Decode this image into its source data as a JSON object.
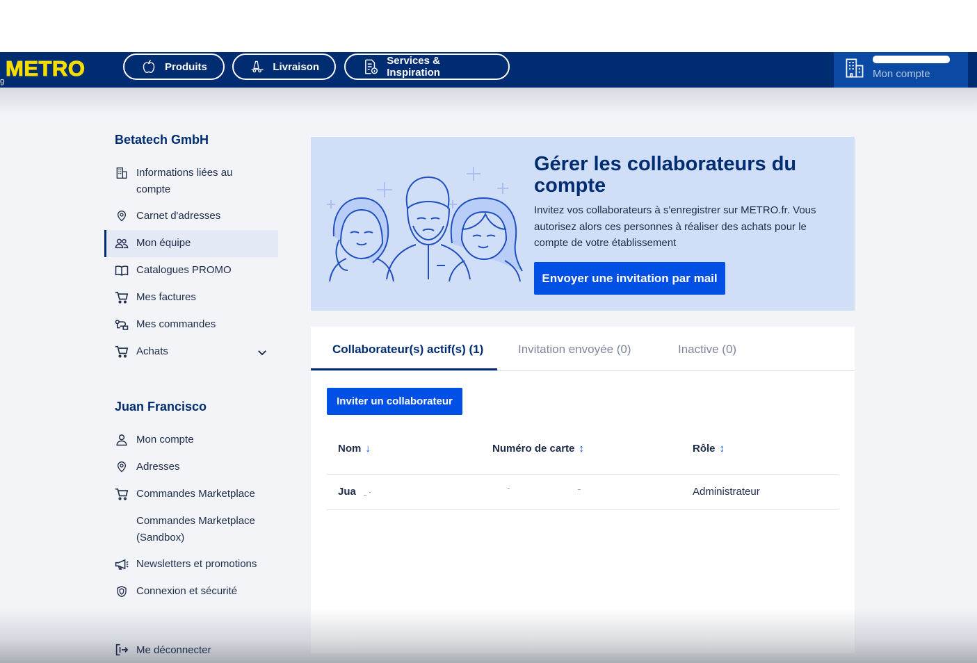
{
  "header": {
    "logo": "METRO",
    "logo_fragment": "g",
    "nav": [
      {
        "label": "Produits",
        "icon": "apple-icon"
      },
      {
        "label": "Livraison",
        "icon": "delivery-icon"
      },
      {
        "label": "Services & Inspiration",
        "icon": "services-doc-icon"
      }
    ],
    "account_label": "Mon compte",
    "account_icon": "building-icon"
  },
  "sidebar": {
    "company_title": "Betatech GmbH",
    "company_items": [
      {
        "label": "Informations liées au compte",
        "icon": "building-icon"
      },
      {
        "label": "Carnet d'adresses",
        "icon": "location-pin-icon"
      },
      {
        "label": "Mon équipe",
        "icon": "team-icon",
        "active": true
      },
      {
        "label": "Catalogues PROMO",
        "icon": "book-icon"
      },
      {
        "label": "Mes factures",
        "icon": "cart-icon"
      },
      {
        "label": "Mes commandes",
        "icon": "orders-icon"
      },
      {
        "label": "Achats",
        "icon": "cart-icon",
        "expandable": true
      }
    ],
    "user_title": "Juan Francisco",
    "user_items": [
      {
        "label": "Mon compte",
        "icon": "user-icon"
      },
      {
        "label": "Adresses",
        "icon": "location-pin-icon"
      },
      {
        "label": "Commandes Marketplace",
        "icon": "cart-icon"
      },
      {
        "label": "Commandes Marketplace (Sandbox)",
        "icon": ""
      },
      {
        "label": "Newsletters et promotions",
        "icon": "megaphone-icon"
      },
      {
        "label": "Connexion et sécurité",
        "icon": "shield-icon"
      }
    ],
    "logout": "Me déconnecter"
  },
  "banner": {
    "title": "Gérer les collaborateurs du compte",
    "text": "Invitez vos collaborateurs à s'enregistrer sur METRO.fr. Vous autorisez alors ces personnes à réaliser des achats pour le compte de votre établissement",
    "button": "Envoyer une invitation par mail"
  },
  "tabs": [
    {
      "label": "Collaborateur(s) actif(s) (1)",
      "active": true
    },
    {
      "label": "Invitation envoyée (0)",
      "active": false
    },
    {
      "label": "Inactive (0)",
      "active": false
    }
  ],
  "invite_button": "Inviter un collaborateur",
  "table": {
    "columns": [
      {
        "label": "Nom",
        "sort": "↓"
      },
      {
        "label": "Numéro de carte",
        "sort": "↕"
      },
      {
        "label": "Rôle",
        "sort": "↕"
      }
    ],
    "rows": [
      {
        "name": "Jua",
        "card": "",
        "role": "Administrateur"
      }
    ]
  },
  "colors": {
    "navy": "#002d72",
    "accent_blue": "#0050e6",
    "logo_yellow": "#f5dd00",
    "banner_bg": "#d1def8"
  }
}
